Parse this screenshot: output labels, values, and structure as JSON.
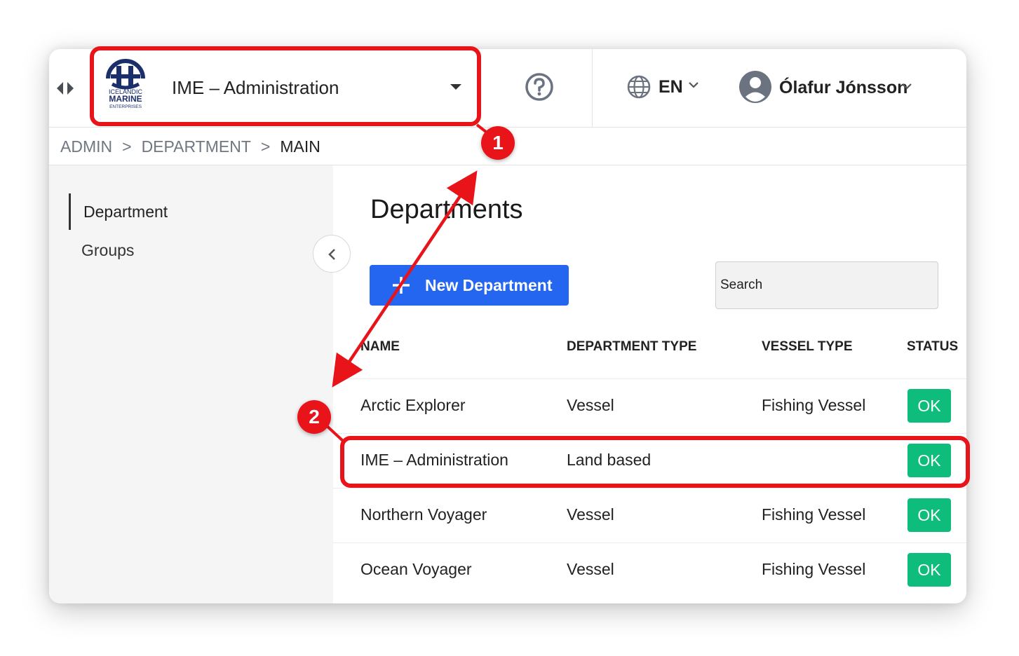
{
  "header": {
    "logo_text": [
      "ICELANDIC",
      "MARINE",
      "ENTERPRISES"
    ],
    "org_selector": "IME – Administration",
    "language": "EN",
    "user_name": "Ólafur Jónsson"
  },
  "breadcrumb": {
    "items": [
      "ADMIN",
      "DEPARTMENT",
      "MAIN"
    ],
    "separator": ">"
  },
  "sidebar": {
    "items": [
      "Department",
      "Groups"
    ]
  },
  "main": {
    "title": "Departments",
    "new_button": "New Department",
    "search_placeholder": "Search",
    "columns": [
      "NAME",
      "DEPARTMENT TYPE",
      "VESSEL TYPE",
      "STATUS"
    ],
    "rows": [
      {
        "name": "Arctic Explorer",
        "type": "Vessel",
        "vessel_type": "Fishing Vessel",
        "status": "OK"
      },
      {
        "name": "IME – Administration",
        "type": "Land based",
        "vessel_type": "",
        "status": "OK"
      },
      {
        "name": "Northern Voyager",
        "type": "Vessel",
        "vessel_type": "Fishing Vessel",
        "status": "OK"
      },
      {
        "name": "Ocean Voyager",
        "type": "Vessel",
        "vessel_type": "Fishing Vessel",
        "status": "OK"
      }
    ]
  },
  "annotations": {
    "marker_1": "1",
    "marker_2": "2"
  },
  "colors": {
    "primary": "#2466f0",
    "status_ok": "#0ebd7c",
    "annotation": "#e8141a",
    "logo": "#1b2f6b"
  }
}
